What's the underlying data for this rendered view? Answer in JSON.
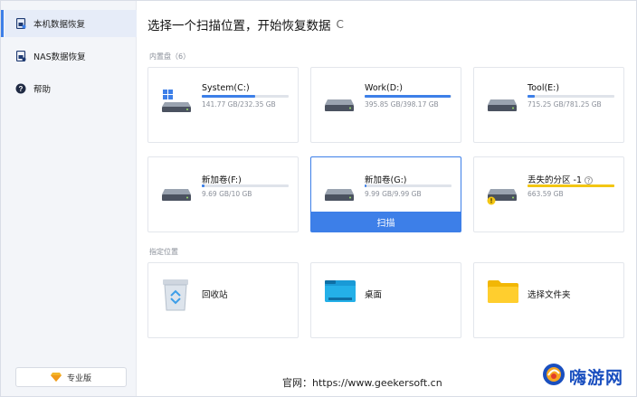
{
  "sidebar": {
    "items": [
      {
        "label": "本机数据恢复",
        "icon": "local-recovery-icon",
        "active": true
      },
      {
        "label": "NAS数据恢复",
        "icon": "nas-recovery-icon",
        "active": false
      },
      {
        "label": "帮助",
        "icon": "help-icon",
        "active": false
      }
    ],
    "pro_label": "专业版"
  },
  "main": {
    "title": "选择一个扫描位置，开始恢复数据",
    "refresh_glyph": "C",
    "drives_label": "内置盘（6）",
    "locations_label": "指定位置",
    "scan_label": "扫描",
    "drives": [
      {
        "name": "System(C:)",
        "size": "141.77 GB/232.35 GB",
        "used": 0.61,
        "bar_color": "#3d7fe8"
      },
      {
        "name": "Work(D:)",
        "size": "395.85 GB/398.17 GB",
        "used": 0.99,
        "bar_color": "#3d7fe8"
      },
      {
        "name": "Tool(E:)",
        "size": "715.25 GB/781.25 GB",
        "used": 0.08,
        "bar_color": "#3d7fe8"
      },
      {
        "name": "新加卷(F:)",
        "size": "9.69 GB/10 GB",
        "used": 0.03,
        "bar_color": "#3d7fe8"
      },
      {
        "name": "新加卷(G:)",
        "size": "9.99 GB/9.99 GB",
        "used": 0.02,
        "bar_color": "#3d7fe8"
      },
      {
        "name": "丢失的分区 -1",
        "size": "663.59 GB",
        "used": 1.0,
        "bar_color": "#f3c613"
      }
    ],
    "locations": [
      {
        "name": "回收站",
        "icon": "recycle-bin-icon"
      },
      {
        "name": "桌面",
        "icon": "desktop-icon"
      },
      {
        "name": "选择文件夹",
        "icon": "folder-icon"
      }
    ]
  },
  "watermark": "官网：https://www.geekersoft.cn",
  "logo_text": "嗨游网",
  "colors": {
    "accent": "#3d7fe8",
    "warning": "#f3c613",
    "sidebar_bg": "#f3f5f9"
  }
}
